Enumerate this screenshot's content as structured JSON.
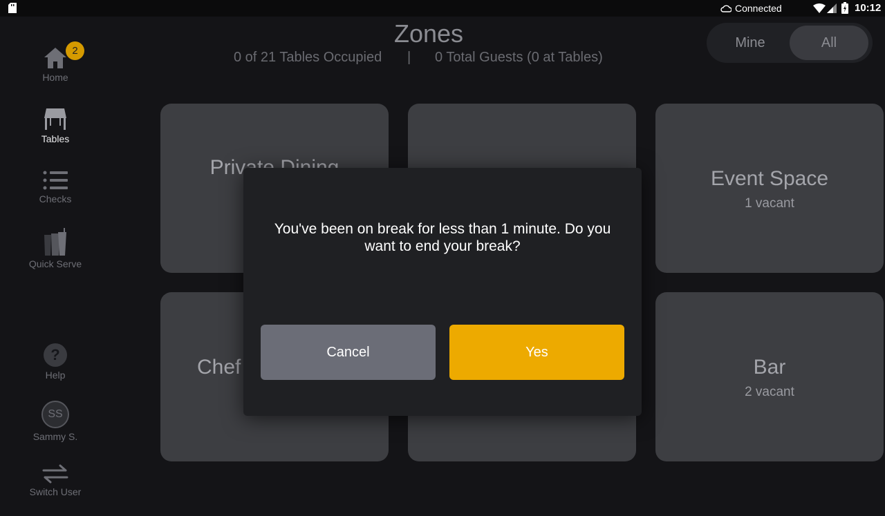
{
  "status_bar": {
    "connection": "Connected",
    "time": "10:12",
    "icons": [
      "sd-card-icon",
      "cloud-icon",
      "wifi-icon",
      "cell-signal-icon",
      "battery-charging-icon"
    ]
  },
  "sidebar": {
    "items": [
      {
        "label": "Home",
        "icon": "home-icon",
        "badge": "2"
      },
      {
        "label": "Tables",
        "icon": "table-icon",
        "active": true
      },
      {
        "label": "Checks",
        "icon": "list-icon"
      },
      {
        "label": "Quick Serve",
        "icon": "quick-serve-icon"
      },
      {
        "label": "Help",
        "icon": "help-icon",
        "glyph": "?"
      },
      {
        "label": "Sammy S.",
        "icon": "avatar",
        "initials": "SS"
      },
      {
        "label": "Switch User",
        "icon": "switch-user-icon"
      }
    ]
  },
  "header": {
    "title": "Zones",
    "occupied": "0 of 21 Tables Occupied",
    "separator": "|",
    "guests": "0 Total Guests (0 at Tables)"
  },
  "filter_toggle": {
    "options": [
      "Mine",
      "All"
    ],
    "selected": "All"
  },
  "zones": [
    {
      "name": "Private Dining",
      "status": ""
    },
    {
      "name": "",
      "status": ""
    },
    {
      "name": "Event Space",
      "status": "1 vacant"
    },
    {
      "name": "Chef",
      "status": ""
    },
    {
      "name": "",
      "status": ""
    },
    {
      "name": "Bar",
      "status": "2 vacant"
    }
  ],
  "dialog": {
    "message": "You've been on break for less than 1 minute. Do you want to end your break?",
    "cancel_label": "Cancel",
    "yes_label": "Yes"
  },
  "colors": {
    "accent": "#edaa00",
    "badge": "#d59a00",
    "background": "#141417",
    "tile": "#3d3e42",
    "cancel_button": "#6b6d77"
  }
}
